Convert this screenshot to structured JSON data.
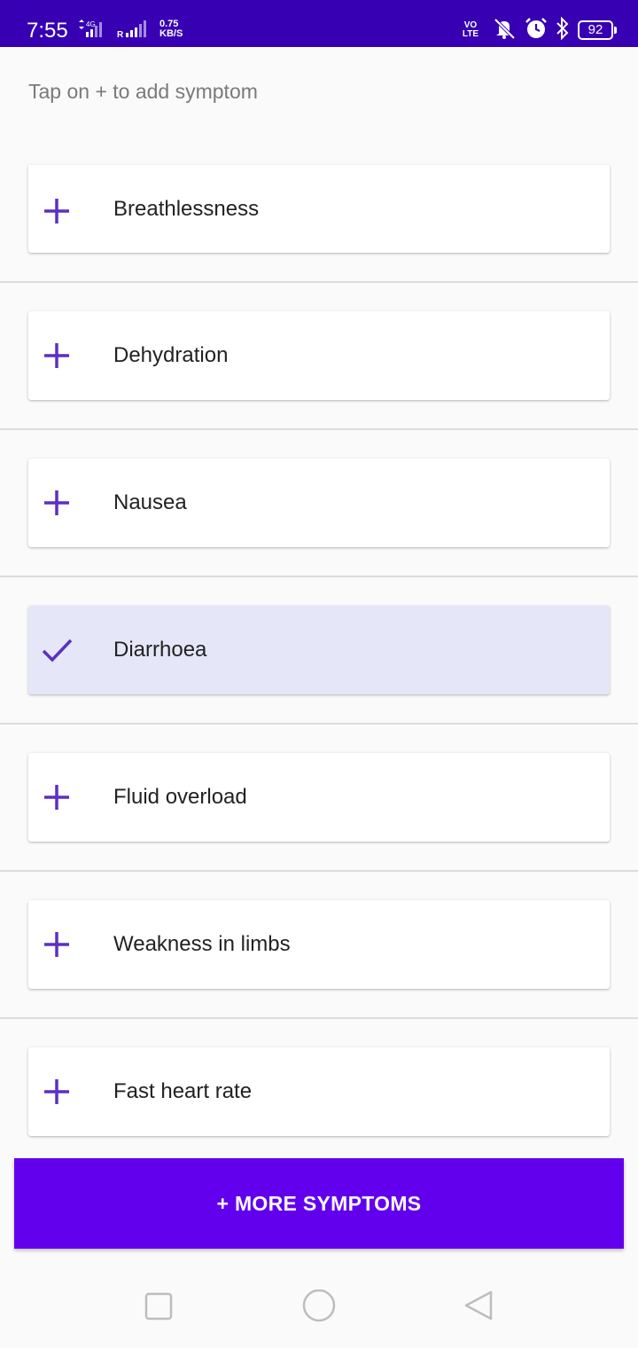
{
  "status_bar": {
    "time": "7:55",
    "network": "4G",
    "roaming": "R",
    "speed_value": "0.75",
    "speed_unit": "KB/S",
    "volte_line1": "VO",
    "volte_line2": "LTE",
    "battery": "92",
    "color": "#3700b3"
  },
  "hint": "Tap on + to add symptom",
  "symptoms": [
    {
      "label": "Breathlessness",
      "icon": "plus-icon",
      "selected": false
    },
    {
      "label": "Dehydration",
      "icon": "plus-icon",
      "selected": false
    },
    {
      "label": "Nausea",
      "icon": "plus-icon",
      "selected": false
    },
    {
      "label": "Diarrhoea",
      "icon": "checkmark-icon",
      "selected": true
    },
    {
      "label": "Fluid overload",
      "icon": "plus-icon",
      "selected": false
    },
    {
      "label": "Weakness in limbs",
      "icon": "plus-icon",
      "selected": false
    },
    {
      "label": "Fast heart rate",
      "icon": "plus-icon",
      "selected": false
    }
  ],
  "more_button": {
    "label": "+ MORE SYMPTOMS"
  },
  "colors": {
    "accent": "#5c2fc2",
    "button": "#6200ee",
    "selected_bg": "#e5e7f8"
  },
  "nav": {
    "icons": [
      "recents-square-icon",
      "home-circle-icon",
      "back-triangle-icon"
    ]
  }
}
